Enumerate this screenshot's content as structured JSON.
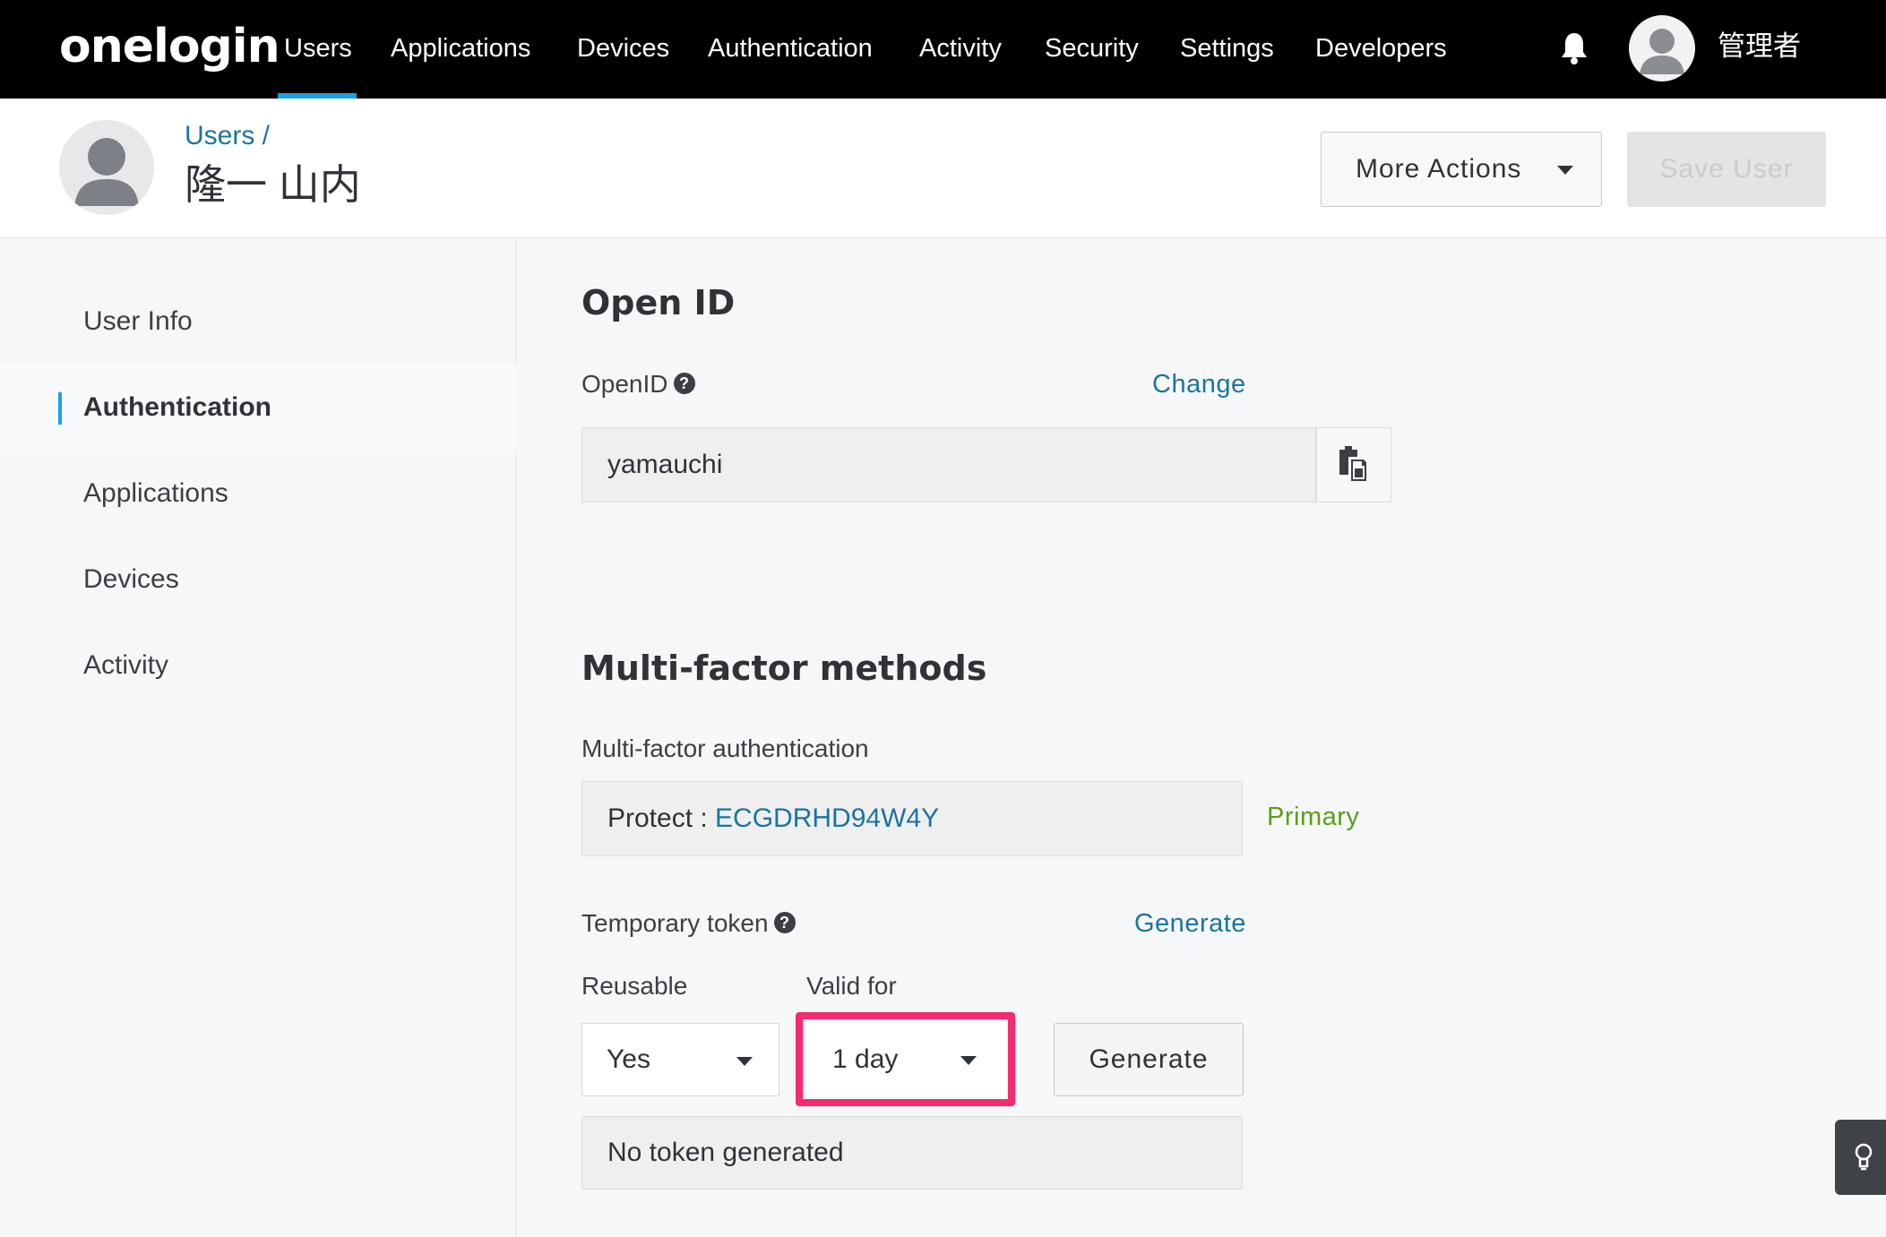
{
  "nav": {
    "logo": "onelogin",
    "items": [
      "Users",
      "Applications",
      "Devices",
      "Authentication",
      "Activity",
      "Security",
      "Settings",
      "Developers"
    ],
    "admin_name": "管理者"
  },
  "header": {
    "breadcrumb": "Users /",
    "title": "隆一 山内",
    "more_actions": "More Actions",
    "save_user": "Save User"
  },
  "sidebar": {
    "items": [
      "User Info",
      "Authentication",
      "Applications",
      "Devices",
      "Activity"
    ],
    "active": "Authentication"
  },
  "openid": {
    "section_title": "Open ID",
    "label": "OpenID",
    "change_link": "Change",
    "value": "yamauchi"
  },
  "mfa": {
    "section_title": "Multi-factor methods",
    "label": "Multi-factor authentication",
    "method_prefix": "Protect : ",
    "method_id": "ECGDRHD94W4Y",
    "primary": "Primary"
  },
  "token": {
    "label": "Temporary token",
    "generate_link": "Generate",
    "reusable_label": "Reusable",
    "reusable_value": "Yes",
    "valid_label": "Valid for",
    "valid_value": "1 day",
    "generate_button": "Generate",
    "status": "No token generated"
  },
  "colors": {
    "accent": "#1ba2dc",
    "link": "#1a759f",
    "primary": "#5a9e1a",
    "highlight": "#f52a6f"
  }
}
